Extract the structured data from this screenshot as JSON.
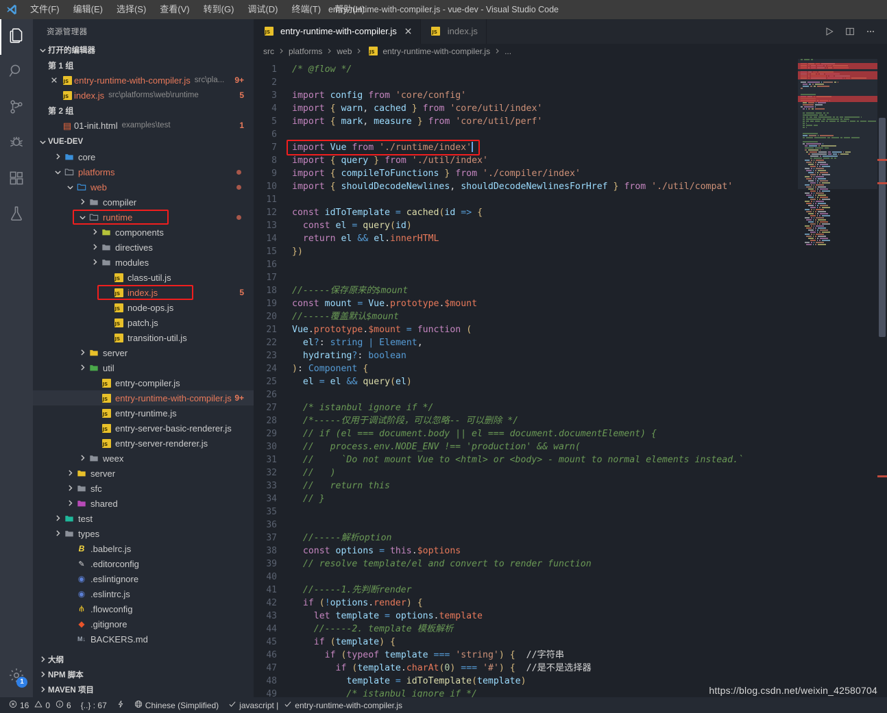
{
  "window": {
    "title": "entry-runtime-with-compiler.js - vue-dev - Visual Studio Code",
    "logo_icon": "vscode-logo"
  },
  "menu": [
    {
      "label": "文件(F)"
    },
    {
      "label": "编辑(E)"
    },
    {
      "label": "选择(S)"
    },
    {
      "label": "查看(V)"
    },
    {
      "label": "转到(G)"
    },
    {
      "label": "调试(D)"
    },
    {
      "label": "终端(T)"
    },
    {
      "label": "帮助(H)"
    }
  ],
  "activitybar": {
    "items": [
      {
        "icon": "files-explorer-icon",
        "name": "explorer",
        "active": true
      },
      {
        "icon": "search-icon",
        "name": "search",
        "active": false
      },
      {
        "icon": "source-control-icon",
        "name": "source-control",
        "active": false
      },
      {
        "icon": "debug-icon",
        "name": "debug",
        "active": false
      },
      {
        "icon": "extensions-icon",
        "name": "extensions",
        "active": false
      },
      {
        "icon": "testing-flask-icon",
        "name": "testing",
        "active": false
      }
    ],
    "settings": {
      "icon": "gear-icon",
      "badge": "1"
    }
  },
  "sidebar": {
    "title": "资源管理器",
    "open_editors": {
      "header": "打开的编辑器",
      "groups": [
        {
          "name": "第 1 组",
          "files": [
            {
              "name": "entry-runtime-with-compiler.js",
              "desc": "src\\pla...",
              "count": "9+",
              "icon": "js-file-icon",
              "closable": true,
              "modified": true,
              "selected": true
            },
            {
              "name": "index.js",
              "desc": "src\\platforms\\web\\runtime",
              "count": "5",
              "icon": "js-file-icon",
              "closable": false,
              "modified": true,
              "selected": false
            }
          ]
        },
        {
          "name": "第 2 组",
          "files": [
            {
              "name": "01-init.html",
              "desc": "examples\\test",
              "count": "1",
              "icon": "html-file-icon",
              "closable": false,
              "modified": false,
              "selected": false
            }
          ]
        }
      ]
    },
    "project": {
      "header": "VUE-DEV",
      "tree": [
        {
          "label": "core",
          "type": "folder",
          "icon": "folder-core-icon",
          "depth": 1,
          "expanded": false,
          "modified": false,
          "dot": false,
          "count": ""
        },
        {
          "label": "platforms",
          "type": "folder",
          "icon": "folder-open-icon",
          "depth": 1,
          "expanded": true,
          "modified": true,
          "dot": true,
          "count": ""
        },
        {
          "label": "web",
          "type": "folder",
          "icon": "folder-web-icon",
          "depth": 2,
          "expanded": true,
          "modified": true,
          "dot": true,
          "count": ""
        },
        {
          "label": "compiler",
          "type": "folder",
          "icon": "folder-icon",
          "depth": 3,
          "expanded": false,
          "modified": false,
          "dot": false,
          "count": ""
        },
        {
          "label": "runtime",
          "type": "folder",
          "icon": "folder-open-icon",
          "depth": 3,
          "expanded": true,
          "modified": true,
          "dot": true,
          "count": "",
          "highlighted": true
        },
        {
          "label": "components",
          "type": "folder",
          "icon": "folder-components-icon",
          "depth": 4,
          "expanded": false,
          "modified": false,
          "dot": false,
          "count": ""
        },
        {
          "label": "directives",
          "type": "folder",
          "icon": "folder-icon",
          "depth": 4,
          "expanded": false,
          "modified": false,
          "dot": false,
          "count": ""
        },
        {
          "label": "modules",
          "type": "folder",
          "icon": "folder-icon",
          "depth": 4,
          "expanded": false,
          "modified": false,
          "dot": false,
          "count": ""
        },
        {
          "label": "class-util.js",
          "type": "file",
          "icon": "js-file-icon",
          "depth": 5,
          "modified": false,
          "count": ""
        },
        {
          "label": "index.js",
          "type": "file",
          "icon": "js-file-icon",
          "depth": 5,
          "modified": true,
          "count": "5",
          "highlighted": true
        },
        {
          "label": "node-ops.js",
          "type": "file",
          "icon": "js-file-icon",
          "depth": 5,
          "modified": false,
          "count": ""
        },
        {
          "label": "patch.js",
          "type": "file",
          "icon": "js-file-icon",
          "depth": 5,
          "modified": false,
          "count": ""
        },
        {
          "label": "transition-util.js",
          "type": "file",
          "icon": "js-file-icon",
          "depth": 5,
          "modified": false,
          "count": ""
        },
        {
          "label": "server",
          "type": "folder",
          "icon": "folder-server-icon",
          "depth": 3,
          "expanded": false,
          "modified": false,
          "dot": false,
          "count": ""
        },
        {
          "label": "util",
          "type": "folder",
          "icon": "folder-util-icon",
          "depth": 3,
          "expanded": false,
          "modified": false,
          "dot": false,
          "count": ""
        },
        {
          "label": "entry-compiler.js",
          "type": "file",
          "icon": "js-file-icon",
          "depth": 4,
          "modified": false,
          "count": ""
        },
        {
          "label": "entry-runtime-with-compiler.js",
          "type": "file",
          "icon": "js-file-icon",
          "depth": 4,
          "modified": true,
          "count": "9+",
          "selected": true
        },
        {
          "label": "entry-runtime.js",
          "type": "file",
          "icon": "js-file-icon",
          "depth": 4,
          "modified": false,
          "count": ""
        },
        {
          "label": "entry-server-basic-renderer.js",
          "type": "file",
          "icon": "js-file-icon",
          "depth": 4,
          "modified": false,
          "count": ""
        },
        {
          "label": "entry-server-renderer.js",
          "type": "file",
          "icon": "js-file-icon",
          "depth": 4,
          "modified": false,
          "count": ""
        },
        {
          "label": "weex",
          "type": "folder",
          "icon": "folder-icon",
          "depth": 3,
          "expanded": false,
          "modified": false,
          "dot": false,
          "count": ""
        },
        {
          "label": "server",
          "type": "folder",
          "icon": "folder-server-icon",
          "depth": 2,
          "expanded": false,
          "modified": false,
          "dot": false,
          "count": ""
        },
        {
          "label": "sfc",
          "type": "folder",
          "icon": "folder-icon",
          "depth": 2,
          "expanded": false,
          "modified": false,
          "dot": false,
          "count": ""
        },
        {
          "label": "shared",
          "type": "folder",
          "icon": "folder-shared-icon",
          "depth": 2,
          "expanded": false,
          "modified": false,
          "dot": false,
          "count": ""
        },
        {
          "label": "test",
          "type": "folder",
          "icon": "folder-test-icon",
          "depth": 1,
          "expanded": false,
          "modified": false,
          "dot": false,
          "count": ""
        },
        {
          "label": "types",
          "type": "folder",
          "icon": "folder-icon",
          "depth": 1,
          "expanded": false,
          "modified": false,
          "dot": false,
          "count": ""
        },
        {
          "label": ".babelrc.js",
          "type": "file",
          "icon": "babel-icon",
          "depth": 2,
          "modified": false,
          "count": ""
        },
        {
          "label": ".editorconfig",
          "type": "file",
          "icon": "editorconfig-icon",
          "depth": 2,
          "modified": false,
          "count": ""
        },
        {
          "label": ".eslintignore",
          "type": "file",
          "icon": "eslint-icon",
          "depth": 2,
          "modified": false,
          "count": ""
        },
        {
          "label": ".eslintrc.js",
          "type": "file",
          "icon": "eslint-icon",
          "depth": 2,
          "modified": false,
          "count": ""
        },
        {
          "label": ".flowconfig",
          "type": "file",
          "icon": "flow-icon",
          "depth": 2,
          "modified": false,
          "count": ""
        },
        {
          "label": ".gitignore",
          "type": "file",
          "icon": "git-icon",
          "depth": 2,
          "modified": false,
          "count": ""
        },
        {
          "label": "BACKERS.md",
          "type": "file",
          "icon": "markdown-icon",
          "depth": 2,
          "modified": false,
          "count": ""
        }
      ]
    },
    "panels": [
      {
        "label": "大纲"
      },
      {
        "label": "NPM 脚本"
      },
      {
        "label": "MAVEN 项目"
      }
    ]
  },
  "editor": {
    "tabs": [
      {
        "label": "entry-runtime-with-compiler.js",
        "icon": "js-file-icon",
        "active": true,
        "closable": true
      },
      {
        "label": "index.js",
        "icon": "js-file-icon",
        "active": false,
        "closable": false
      }
    ],
    "actions": [
      {
        "icon": "run-play-icon",
        "name": "run-button"
      },
      {
        "icon": "split-editor-icon",
        "name": "split-editor-button"
      },
      {
        "icon": "more-actions-icon",
        "name": "more-actions-button"
      }
    ],
    "breadcrumbs": [
      "src",
      "platforms",
      "web",
      "entry-runtime-with-compiler.js",
      "..."
    ],
    "highlighted_line": 7,
    "cursor_line": 7,
    "lines": [
      {
        "n": 1,
        "text": "/* @flow */"
      },
      {
        "n": 2,
        "text": ""
      },
      {
        "n": 3,
        "text": "import config from 'core/config'"
      },
      {
        "n": 4,
        "text": "import { warn, cached } from 'core/util/index'"
      },
      {
        "n": 5,
        "text": "import { mark, measure } from 'core/util/perf'"
      },
      {
        "n": 6,
        "text": ""
      },
      {
        "n": 7,
        "text": "import Vue from './runtime/index'"
      },
      {
        "n": 8,
        "text": "import { query } from './util/index'"
      },
      {
        "n": 9,
        "text": "import { compileToFunctions } from './compiler/index'"
      },
      {
        "n": 10,
        "text": "import { shouldDecodeNewlines, shouldDecodeNewlinesForHref } from './util/compat'"
      },
      {
        "n": 11,
        "text": ""
      },
      {
        "n": 12,
        "text": "const idToTemplate = cached(id => {"
      },
      {
        "n": 13,
        "text": "  const el = query(id)"
      },
      {
        "n": 14,
        "text": "  return el && el.innerHTML"
      },
      {
        "n": 15,
        "text": "})"
      },
      {
        "n": 16,
        "text": ""
      },
      {
        "n": 17,
        "text": ""
      },
      {
        "n": 18,
        "text": "//-----保存原来的$mount"
      },
      {
        "n": 19,
        "text": "const mount = Vue.prototype.$mount"
      },
      {
        "n": 20,
        "text": "//-----覆盖默认$mount"
      },
      {
        "n": 21,
        "text": "Vue.prototype.$mount = function ("
      },
      {
        "n": 22,
        "text": "  el?: string | Element,"
      },
      {
        "n": 23,
        "text": "  hydrating?: boolean"
      },
      {
        "n": 24,
        "text": "): Component {"
      },
      {
        "n": 25,
        "text": "  el = el && query(el)"
      },
      {
        "n": 26,
        "text": ""
      },
      {
        "n": 27,
        "text": "  /* istanbul ignore if */"
      },
      {
        "n": 28,
        "text": "  /*-----仅用于调试阶段，可以忽略-- 可以删除 */"
      },
      {
        "n": 29,
        "text": "  // if (el === document.body || el === document.documentElement) {"
      },
      {
        "n": 30,
        "text": "  //   process.env.NODE_ENV !== 'production' && warn("
      },
      {
        "n": 31,
        "text": "  //     `Do not mount Vue to <html> or <body> - mount to normal elements instead.`"
      },
      {
        "n": 32,
        "text": "  //   )"
      },
      {
        "n": 33,
        "text": "  //   return this"
      },
      {
        "n": 34,
        "text": "  // }"
      },
      {
        "n": 35,
        "text": ""
      },
      {
        "n": 36,
        "text": ""
      },
      {
        "n": 37,
        "text": "  //-----解析option"
      },
      {
        "n": 38,
        "text": "  const options = this.$options"
      },
      {
        "n": 39,
        "text": "  // resolve template/el and convert to render function"
      },
      {
        "n": 40,
        "text": ""
      },
      {
        "n": 41,
        "text": "  //-----1.先判断render"
      },
      {
        "n": 42,
        "text": "  if (!options.render) {"
      },
      {
        "n": 43,
        "text": "    let template = options.template"
      },
      {
        "n": 44,
        "text": "    //-----2. template 模板解析"
      },
      {
        "n": 45,
        "text": "    if (template) {"
      },
      {
        "n": 46,
        "text": "      if (typeof template === 'string') {  //字符串"
      },
      {
        "n": 47,
        "text": "        if (template.charAt(0) === '#') {  //是不是选择器"
      },
      {
        "n": 48,
        "text": "          template = idToTemplate(template)"
      },
      {
        "n": 49,
        "text": "          /* istanbul ignore if */"
      }
    ]
  },
  "statusbar": {
    "left": [
      {
        "icon": "error-circle-icon",
        "value": "16",
        "name": "error-count"
      },
      {
        "icon": "warning-triangle-icon",
        "value": "0",
        "name": "warning-count"
      },
      {
        "icon": "info-circle-icon",
        "value": "6",
        "name": "info-count"
      },
      {
        "icon": "",
        "value": "{..} : 67",
        "name": "braces-count"
      },
      {
        "icon": "bolt-icon",
        "value": "",
        "name": "bolt-status"
      },
      {
        "icon": "globe-icon",
        "value": "Chinese (Simplified)",
        "name": "language-locale"
      },
      {
        "icon": "check-icon",
        "value": "javascript |",
        "name": "javascript-check"
      },
      {
        "icon": "check-icon",
        "value": "entry-runtime-with-compiler.js",
        "name": "file-check"
      }
    ]
  },
  "watermark": "https://blog.csdn.net/weixin_42580704",
  "colors": {
    "accent_red": "#f01e1e",
    "titlebar_bg": "#3c3c3c",
    "sidebar_bg": "#252a33",
    "editor_bg": "#1e2229",
    "modified_text": "#e8795a",
    "badge_blue": "#2f80e7"
  }
}
